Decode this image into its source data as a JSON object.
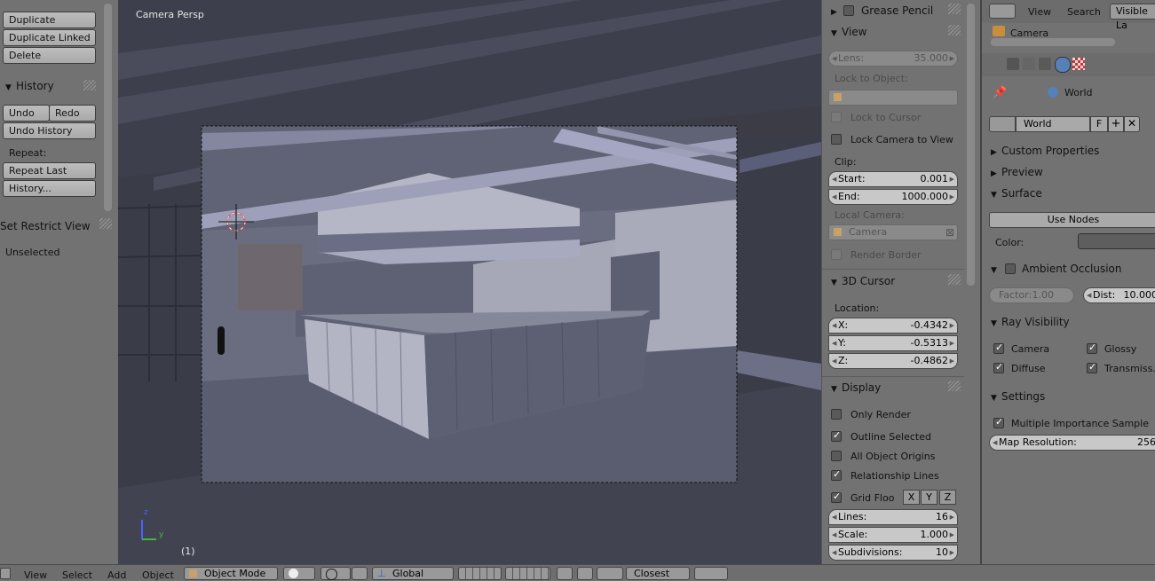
{
  "toolshelf": {
    "buttons": {
      "duplicate": "Duplicate",
      "duplicate_linked": "Duplicate Linked",
      "delete": "Delete"
    },
    "history": {
      "title": "History",
      "undo": "Undo",
      "redo": "Redo",
      "undo_history": "Undo History",
      "repeat_label": "Repeat:",
      "repeat_last": "Repeat Last",
      "history_dots": "History..."
    },
    "restrict": {
      "title": "Set Restrict View",
      "unselected": "Unselected"
    }
  },
  "viewport": {
    "title": "Camera Persp",
    "frame_number": "(1)",
    "axis_z": "z",
    "axis_y": "y"
  },
  "npanel": {
    "grease_pencil": "Grease Pencil",
    "view": {
      "title": "View",
      "lens_label": "Lens:",
      "lens_value": "35.000",
      "lock_to_object": "Lock to Object:",
      "lock_to_cursor": "Lock to Cursor",
      "lock_camera_to_view": "Lock Camera to View",
      "clip": "Clip:",
      "start_label": "Start:",
      "start_value": "0.001",
      "end_label": "End:",
      "end_value": "1000.000",
      "local_camera": "Local Camera:",
      "camera_value": "Camera",
      "render_border": "Render Border"
    },
    "cursor": {
      "title": "3D Cursor",
      "location": "Location:",
      "x_label": "X:",
      "x_value": "-0.4342",
      "y_label": "Y:",
      "y_value": "-0.5313",
      "z_label": "Z:",
      "z_value": "-0.4862"
    },
    "display": {
      "title": "Display",
      "only_render": "Only Render",
      "outline_selected": "Outline Selected",
      "all_object_origins": "All Object Origins",
      "relationship_lines": "Relationship Lines",
      "grid_floor": "Grid Floo",
      "x": "X",
      "y": "Y",
      "z": "Z",
      "lines_label": "Lines:",
      "lines_value": "16",
      "scale_label": "Scale:",
      "scale_value": "1.000",
      "subdivisions_label": "Subdivisions:",
      "subdivisions_value": "10"
    }
  },
  "props": {
    "header": {
      "view": "View",
      "search": "Search",
      "visible_layers": "Visible La"
    },
    "outliner_item": "Camera",
    "breadcrumb_world": "World",
    "world_field": "World",
    "fake_user": "F",
    "custom_properties": "Custom Properties",
    "preview": "Preview",
    "surface": "Surface",
    "use_nodes": "Use Nodes",
    "color_label": "Color:",
    "ambient_occlusion": "Ambient Occlusion",
    "factor_label": "Factor:",
    "factor_value": "1.00",
    "dist_label": "Dist:",
    "dist_value": "10.000",
    "ray_visibility": "Ray Visibility",
    "camera": "Camera",
    "glossy": "Glossy",
    "diffuse": "Diffuse",
    "transmission": "Transmiss...",
    "settings": "Settings",
    "multiple_importance": "Multiple Importance Sample",
    "map_resolution_label": "Map Resolution:",
    "map_resolution_value": "256"
  },
  "bottombar": {
    "view": "View",
    "select": "Select",
    "add": "Add",
    "object": "Object",
    "mode": "Object Mode",
    "orientation": "Global",
    "snap": "Closest"
  }
}
